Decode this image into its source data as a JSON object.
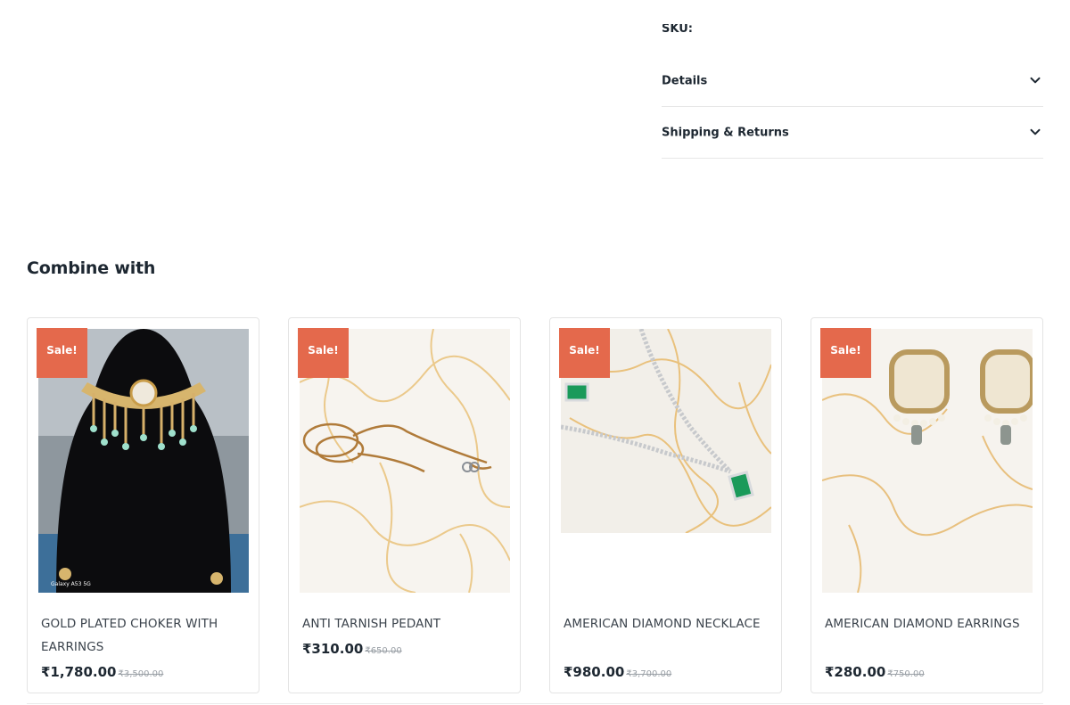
{
  "product_meta": {
    "sku_label": "SKU:",
    "accordion": [
      {
        "label": "Details",
        "icon": "chevron-down-icon"
      },
      {
        "label": "Shipping & Returns",
        "icon": "chevron-down-icon"
      }
    ]
  },
  "combine": {
    "title": "Combine with",
    "products": [
      {
        "badge": "Sale!",
        "name": "GOLD PLATED CHOKER WITH EARRINGS",
        "price": "₹1,780.00",
        "old_price": "₹3,500.00",
        "image_caption": "Galaxy A53 5G"
      },
      {
        "badge": "Sale!",
        "name": "ANTI TARNISH PEDANT",
        "price": "₹310.00",
        "old_price": "₹650.00"
      },
      {
        "badge": "Sale!",
        "name": "AMERICAN DIAMOND NECKLACE",
        "price": "₹980.00",
        "old_price": "₹3,700.00"
      },
      {
        "badge": "Sale!",
        "name": "AMERICAN DIAMOND EARRINGS",
        "price": "₹280.00",
        "old_price": "₹750.00"
      }
    ]
  },
  "colors": {
    "sale_badge": "#e4694c",
    "text_dark": "#1d2731",
    "border": "#e4e4e4"
  }
}
